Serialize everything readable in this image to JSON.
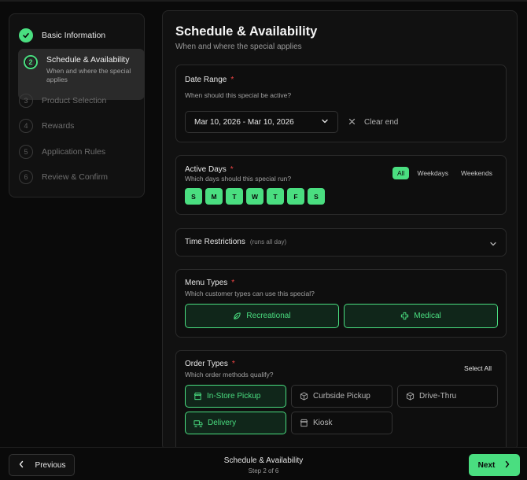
{
  "sidebar": {
    "steps": [
      {
        "number": "1",
        "label": "Basic Information",
        "state": "done"
      },
      {
        "number": "2",
        "label": "Schedule & Availability",
        "desc": "When and where the special applies",
        "state": "active"
      },
      {
        "number": "3",
        "label": "Product Selection",
        "state": "pending"
      },
      {
        "number": "4",
        "label": "Rewards",
        "state": "pending"
      },
      {
        "number": "5",
        "label": "Application Rules",
        "state": "pending"
      },
      {
        "number": "6",
        "label": "Review & Confirm",
        "state": "pending"
      }
    ]
  },
  "main": {
    "title": "Schedule & Availability",
    "subtitle": "When and where the special applies",
    "date_range": {
      "title": "Date Range",
      "required": "*",
      "desc": "When should this special be active?",
      "value": "Mar 10, 2026 - Mar 10, 2026",
      "clear_label": "Clear end"
    },
    "active_days": {
      "title": "Active Days",
      "required": "*",
      "desc": "Which days should this special run?",
      "filters": [
        "All",
        "Weekdays",
        "Weekends"
      ],
      "selected_filter": "All",
      "days": [
        "S",
        "M",
        "T",
        "W",
        "T",
        "F",
        "S"
      ]
    },
    "time_restrictions": {
      "title": "Time Restrictions",
      "hint": "(runs all day)"
    },
    "menu_types": {
      "title": "Menu Types",
      "required": "*",
      "desc": "Which customer types can use this special?",
      "options": [
        "Recreational",
        "Medical"
      ]
    },
    "order_types": {
      "title": "Order Types",
      "required": "*",
      "desc": "Which order methods qualify?",
      "select_all": "Select All",
      "options": [
        "In-Store Pickup",
        "Curbside Pickup",
        "Drive-Thru",
        "Delivery",
        "Kiosk"
      ]
    }
  },
  "footer": {
    "previous": "Previous",
    "title": "Schedule & Availability",
    "step": "Step 2 of 6",
    "next": "Next"
  },
  "colors": {
    "accent": "#4ade80",
    "required": "#ef4444",
    "background": "#0a0a0a",
    "card": "#111111"
  }
}
